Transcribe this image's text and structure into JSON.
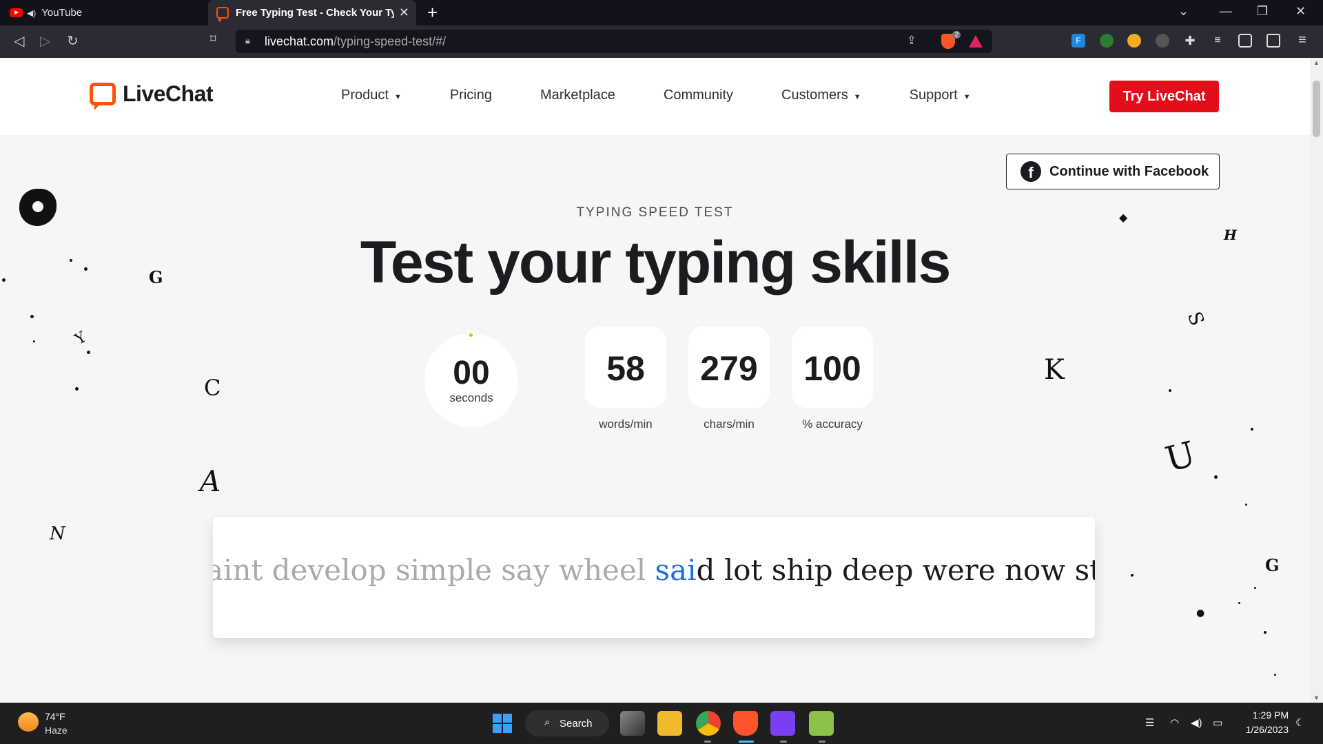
{
  "browser": {
    "tabs": [
      {
        "title": "YouTube",
        "active": false
      },
      {
        "title": "Free Typing Test - Check Your Typing Speed",
        "active": true
      }
    ],
    "url_host": "livechat.com",
    "url_path": "/typing-speed-test/#/",
    "shield_count": "2"
  },
  "site": {
    "logo_text": "LiveChat",
    "nav": [
      {
        "label": "Product",
        "has_caret": true
      },
      {
        "label": "Pricing",
        "has_caret": false
      },
      {
        "label": "Marketplace",
        "has_caret": false
      },
      {
        "label": "Community",
        "has_caret": false
      },
      {
        "label": "Customers",
        "has_caret": true
      },
      {
        "label": "Support",
        "has_caret": true
      }
    ],
    "cta_label": "Try LiveChat",
    "facebook_label": "Continue with Facebook",
    "accent_color": "#e50c1c",
    "brand_color": "#ff5100"
  },
  "hero": {
    "eyebrow": "TYPING SPEED TEST",
    "title": "Test your typing skills"
  },
  "stats": {
    "timer_value": "00",
    "timer_unit": "seconds",
    "wpm_value": "58",
    "wpm_label": "words/min",
    "cpm_value": "279",
    "cpm_label": "chars/min",
    "accuracy_value": "100",
    "accuracy_label": "% accuracy"
  },
  "typing": {
    "typed_text": "aint develop simple say wheel ",
    "current_typed": "sai",
    "current_rest": "d",
    "upcoming_text": " lot ship deep were now stay ago",
    "typed_color": "#a9a9ae",
    "current_color": "#1b6ee6"
  },
  "decor_letters": [
    "G",
    "Y",
    "C",
    "A",
    "N",
    "H",
    "S",
    "K",
    "U",
    "G"
  ],
  "taskbar": {
    "weather_temp": "74°F",
    "weather_condition": "Haze",
    "search_label": "Search",
    "time": "1:29 PM",
    "date": "1/26/2023"
  }
}
